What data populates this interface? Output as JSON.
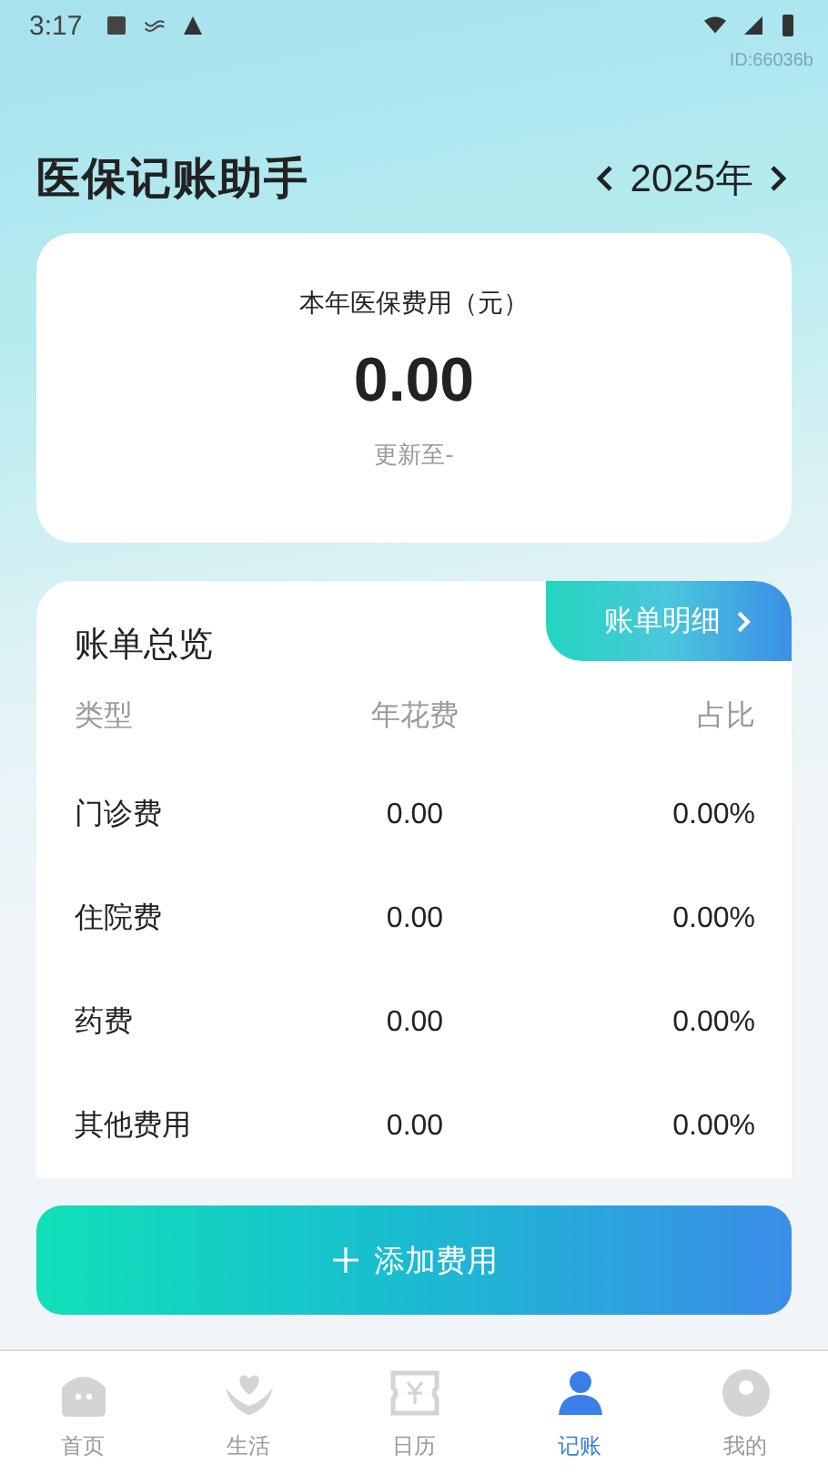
{
  "status_bar": {
    "time": "3:17"
  },
  "device_id": "ID:66036b",
  "header": {
    "title": "医保记账助手",
    "year": "2025年"
  },
  "summary": {
    "label": "本年医保费用（元）",
    "amount": "0.00",
    "updated": "更新至-"
  },
  "overview": {
    "title": "账单总览",
    "detail_link": "账单明细",
    "columns": [
      "类型",
      "年花费",
      "占比"
    ],
    "rows": [
      {
        "type": "门诊费",
        "cost": "0.00",
        "share": "0.00%"
      },
      {
        "type": "住院费",
        "cost": "0.00",
        "share": "0.00%"
      },
      {
        "type": "药费",
        "cost": "0.00",
        "share": "0.00%"
      },
      {
        "type": "其他费用",
        "cost": "0.00",
        "share": "0.00%"
      }
    ]
  },
  "add_button": "添加费用",
  "tabs": [
    {
      "label": "首页",
      "kind": "home",
      "selected": false
    },
    {
      "label": "生活",
      "kind": "life",
      "selected": false
    },
    {
      "label": "日历",
      "kind": "calendar",
      "selected": false
    },
    {
      "label": "记账",
      "kind": "ledger",
      "selected": true
    },
    {
      "label": "我的",
      "kind": "me",
      "selected": false
    }
  ]
}
